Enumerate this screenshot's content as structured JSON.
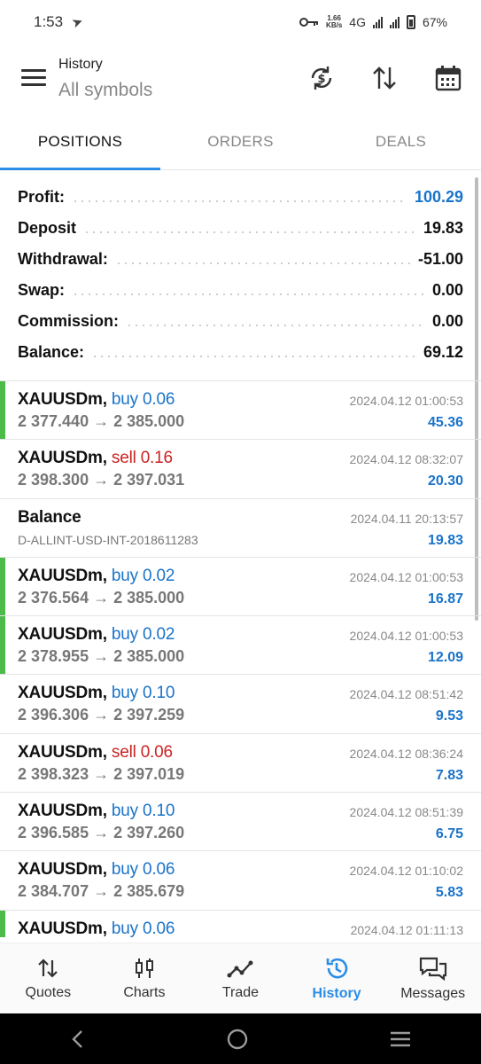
{
  "status": {
    "time": "1:53",
    "net_speed_value": "1.66",
    "net_speed_unit": "KB/s",
    "network": "4G",
    "battery": "67%"
  },
  "header": {
    "title": "History",
    "subtitle": "All symbols"
  },
  "tabs": [
    {
      "label": "POSITIONS",
      "active": true
    },
    {
      "label": "ORDERS",
      "active": false
    },
    {
      "label": "DEALS",
      "active": false
    }
  ],
  "summary": [
    {
      "label": "Profit:",
      "value": "100.29"
    },
    {
      "label": "Deposit",
      "value": "19.83"
    },
    {
      "label": "Withdrawal:",
      "value": "-51.00"
    },
    {
      "label": "Swap:",
      "value": "0.00"
    },
    {
      "label": "Commission:",
      "value": "0.00"
    },
    {
      "label": "Balance:",
      "value": "69.12"
    }
  ],
  "positions": [
    {
      "symbol": "XAUUSDm,",
      "side": "buy 0.06",
      "prices": "2 377.440 → 2 385.000",
      "time": "2024.04.12 01:00:53",
      "profit": "45.36"
    },
    {
      "symbol": "XAUUSDm,",
      "side": "sell 0.16",
      "prices": "2 398.300 → 2 397.031",
      "time": "2024.04.12 08:32:07",
      "profit": "20.30"
    },
    {
      "symbol": "Balance",
      "side": "",
      "prices": "D-ALLINT-USD-INT-2018611283",
      "time": "2024.04.11 20:13:57",
      "profit": "19.83"
    },
    {
      "symbol": "XAUUSDm,",
      "side": "buy 0.02",
      "prices": "2 376.564 → 2 385.000",
      "time": "2024.04.12 01:00:53",
      "profit": "16.87"
    },
    {
      "symbol": "XAUUSDm,",
      "side": "buy 0.02",
      "prices": "2 378.955 → 2 385.000",
      "time": "2024.04.12 01:00:53",
      "profit": "12.09"
    },
    {
      "symbol": "XAUUSDm,",
      "side": "buy 0.10",
      "prices": "2 396.306 → 2 397.259",
      "time": "2024.04.12 08:51:42",
      "profit": "9.53"
    },
    {
      "symbol": "XAUUSDm,",
      "side": "sell 0.06",
      "prices": "2 398.323 → 2 397.019",
      "time": "2024.04.12 08:36:24",
      "profit": "7.83"
    },
    {
      "symbol": "XAUUSDm,",
      "side": "buy 0.10",
      "prices": "2 396.585 → 2 397.260",
      "time": "2024.04.12 08:51:39",
      "profit": "6.75"
    },
    {
      "symbol": "XAUUSDm,",
      "side": "buy 0.06",
      "prices": "2 384.707 → 2 385.679",
      "time": "2024.04.12 01:10:02",
      "profit": "5.83"
    },
    {
      "symbol": "XAUUSDm,",
      "side": "buy 0.06",
      "prices": "",
      "time": "2024.04.12 01:11:13",
      "profit": ""
    }
  ],
  "bottom_nav": [
    {
      "label": "Quotes",
      "icon": "quotes-icon",
      "active": false
    },
    {
      "label": "Charts",
      "icon": "charts-icon",
      "active": false
    },
    {
      "label": "Trade",
      "icon": "trade-icon",
      "active": false
    },
    {
      "label": "History",
      "icon": "history-icon",
      "active": true
    },
    {
      "label": "Messages",
      "icon": "messages-icon",
      "active": false
    }
  ],
  "colors": {
    "accent": "#2a8de6",
    "buy": "#1a73c9",
    "sell": "#cc2222",
    "open_marker": "#4cbb4a"
  }
}
